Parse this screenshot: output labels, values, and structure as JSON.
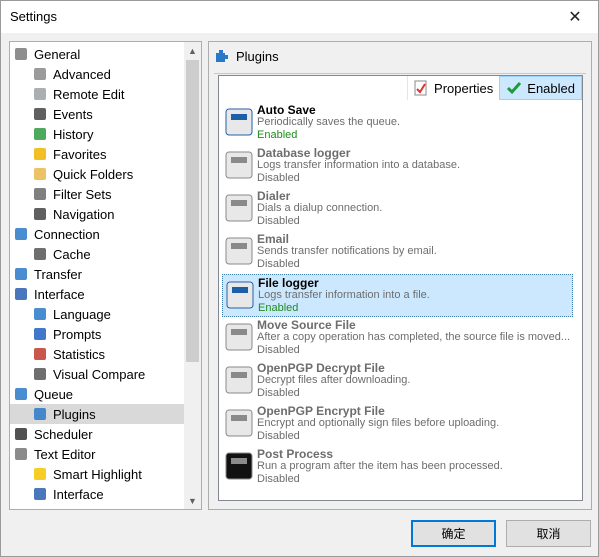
{
  "window": {
    "title": "Settings",
    "close_glyph": "✕"
  },
  "tree": {
    "items": [
      {
        "label": "General",
        "icon": "gears-icon"
      },
      {
        "label": "Advanced",
        "icon": "gear-icon"
      },
      {
        "label": "Remote Edit",
        "icon": "document-icon"
      },
      {
        "label": "Events",
        "icon": "speaker-icon"
      },
      {
        "label": "History",
        "icon": "history-icon"
      },
      {
        "label": "Favorites",
        "icon": "star-icon"
      },
      {
        "label": "Quick Folders",
        "icon": "folder-icon"
      },
      {
        "label": "Filter Sets",
        "icon": "funnel-icon"
      },
      {
        "label": "Navigation",
        "icon": "mouse-icon"
      },
      {
        "label": "Connection",
        "icon": "connection-icon"
      },
      {
        "label": "Cache",
        "icon": "cache-icon"
      },
      {
        "label": "Transfer",
        "icon": "transfer-arrows-icon"
      },
      {
        "label": "Interface",
        "icon": "window-icon"
      },
      {
        "label": "Language",
        "icon": "language-icon"
      },
      {
        "label": "Prompts",
        "icon": "shield-icon"
      },
      {
        "label": "Statistics",
        "icon": "chart-icon"
      },
      {
        "label": "Visual Compare",
        "icon": "compare-icon"
      },
      {
        "label": "Queue",
        "icon": "queue-icon"
      },
      {
        "label": "Plugins",
        "icon": "puzzle-icon"
      },
      {
        "label": "Scheduler",
        "icon": "clock-icon"
      },
      {
        "label": "Text Editor",
        "icon": "text-icon"
      },
      {
        "label": "Smart Highlight",
        "icon": "highlight-icon"
      },
      {
        "label": "Interface",
        "icon": "window-icon"
      }
    ]
  },
  "panel": {
    "title": "Plugins",
    "columns": {
      "properties": "Properties",
      "enabled": "Enabled"
    },
    "plugins": [
      {
        "name": "Auto Save",
        "desc": "Periodically saves the queue.",
        "status": "Enabled",
        "icon": "floppy-icon"
      },
      {
        "name": "Database logger",
        "desc": "Logs transfer information into a database.",
        "status": "Disabled",
        "icon": "database-icon"
      },
      {
        "name": "Dialer",
        "desc": "Dials a dialup connection.",
        "status": "Disabled",
        "icon": "phone-icon"
      },
      {
        "name": "Email",
        "desc": "Sends transfer notifications by email.",
        "status": "Disabled",
        "icon": "envelope-icon"
      },
      {
        "name": "File logger",
        "desc": "Logs transfer information into a file.",
        "status": "Enabled",
        "icon": "log-file-icon"
      },
      {
        "name": "Move Source File",
        "desc": "After a copy operation has completed, the source file is moved...",
        "status": "Disabled",
        "icon": "move-file-icon"
      },
      {
        "name": "OpenPGP Decrypt File",
        "desc": "Decrypt files after downloading.",
        "status": "Disabled",
        "icon": "padlock-icon"
      },
      {
        "name": "OpenPGP Encrypt File",
        "desc": "Encrypt and optionally sign files before uploading.",
        "status": "Disabled",
        "icon": "padlock-icon"
      },
      {
        "name": "Post Process",
        "desc": "Run a program after the item has been processed.",
        "status": "Disabled",
        "icon": "terminal-icon"
      }
    ]
  },
  "buttons": {
    "ok": "确定",
    "cancel": "取消"
  }
}
